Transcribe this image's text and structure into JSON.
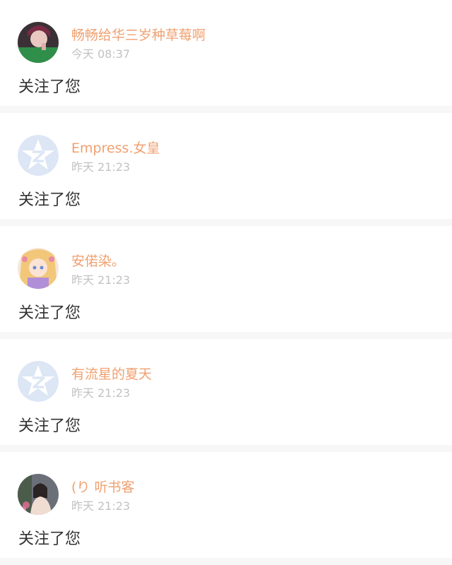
{
  "notifications": [
    {
      "user": "畅畅给华三岁种草莓啊",
      "time": "今天 08:37",
      "action": "关注了您",
      "avatar": "photo-avatar-icon"
    },
    {
      "user": "Empress.女皇",
      "time": "昨天 21:23",
      "action": "关注了您",
      "avatar": "default-avatar-icon"
    },
    {
      "user": "安偌染。",
      "time": "昨天 21:23",
      "action": "关注了您",
      "avatar": "anime-avatar-icon"
    },
    {
      "user": "有流星的夏天",
      "time": "昨天 21:23",
      "action": "关注了您",
      "avatar": "default-avatar-icon"
    },
    {
      "user": "(り 听书客",
      "time": "昨天 21:23",
      "action": "关注了您",
      "avatar": "photo-avatar-icon"
    }
  ],
  "colors": {
    "name": "#f0a070",
    "time": "#c2c2c2",
    "action": "#333333",
    "divider": "#f7f7f7",
    "default_avatar": "#dce6f5"
  }
}
